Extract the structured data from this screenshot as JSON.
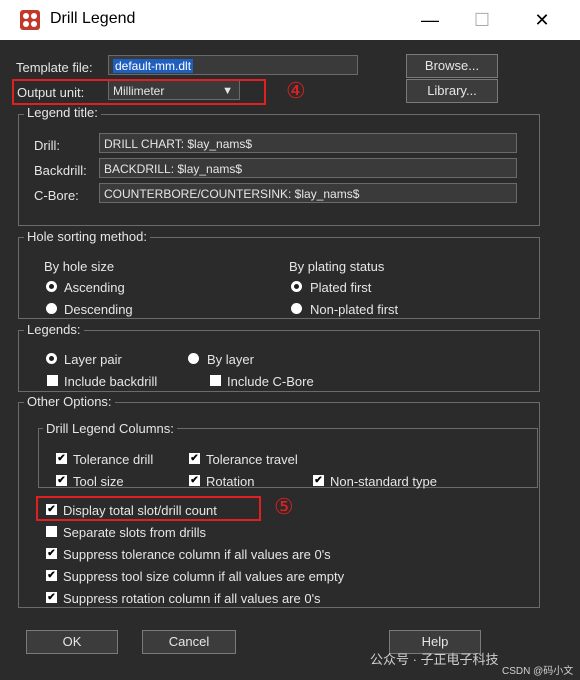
{
  "window": {
    "title": "Drill Legend",
    "minimize": "—",
    "maximize": "☐",
    "close": "✕"
  },
  "template": {
    "label": "Template file:",
    "value": "default-mm.dlt",
    "browse": "Browse..."
  },
  "output": {
    "label": "Output unit:",
    "value": "Millimeter",
    "library": "Library..."
  },
  "legend_title": {
    "group": "Legend title:",
    "rows": [
      {
        "label": "Drill:",
        "value": "DRILL CHART: $lay_nams$"
      },
      {
        "label": "Backdrill:",
        "value": "BACKDRILL: $lay_nams$"
      },
      {
        "label": "C-Bore:",
        "value": "COUNTERBORE/COUNTERSINK: $lay_nams$"
      }
    ]
  },
  "sorting": {
    "group": "Hole sorting method:",
    "by_size": "By hole size",
    "ascending": "Ascending",
    "descending": "Descending",
    "by_plating": "By plating status",
    "plated_first": "Plated first",
    "nonplated_first": "Non-plated first"
  },
  "legends": {
    "group": "Legends:",
    "layer_pair": "Layer pair",
    "by_layer": "By layer",
    "include_backdrill": "Include backdrill",
    "include_cbore": "Include C-Bore"
  },
  "other": {
    "group": "Other Options:",
    "columns_group": "Drill Legend Columns:",
    "tolerance_drill": "Tolerance drill",
    "tolerance_travel": "Tolerance travel",
    "tool_size": "Tool size",
    "rotation": "Rotation",
    "nonstandard": "Non-standard type",
    "display_total": "Display total slot/drill count",
    "separate_slots": "Separate slots from drills",
    "suppress_tol": "Suppress tolerance column if all values are 0's",
    "suppress_tool": "Suppress tool size column if all values are empty",
    "suppress_rot": "Suppress rotation column if all values are 0's"
  },
  "buttons": {
    "ok": "OK",
    "cancel": "Cancel",
    "help": "Help"
  },
  "annotations": {
    "four": "④",
    "five": "⑤"
  },
  "watermark": {
    "text": "公众号 · 子正电子科技",
    "credit": "CSDN @码小文"
  },
  "check": "✔",
  "dropdown_arrow": "▼",
  "colors": {
    "accent": "#1f5fbf",
    "annotation": "#e02020"
  }
}
